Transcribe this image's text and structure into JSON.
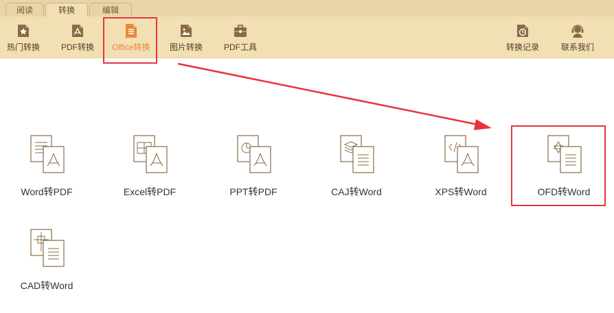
{
  "tabs": [
    {
      "label": "阅读"
    },
    {
      "label": "转换"
    },
    {
      "label": "编辑"
    }
  ],
  "toolbar": {
    "hot": "热门转换",
    "pdf": "PDF转换",
    "office": "Office转换",
    "image": "图片转换",
    "pdftools": "PDF工具",
    "history": "转换记录",
    "contact": "联系我们"
  },
  "tiles": [
    {
      "label": "Word转PDF"
    },
    {
      "label": "Excel转PDF"
    },
    {
      "label": "PPT转PDF"
    },
    {
      "label": "CAJ转Word"
    },
    {
      "label": "XPS转Word"
    },
    {
      "label": "OFD转Word"
    },
    {
      "label": "CAD转Word"
    }
  ],
  "colors": {
    "ribbon": "#f2dfb4",
    "tabbar": "#e9d4a6",
    "icon_brown": "#8a6a45",
    "active_orange": "#e8893a",
    "highlight_red": "#e8333a"
  }
}
